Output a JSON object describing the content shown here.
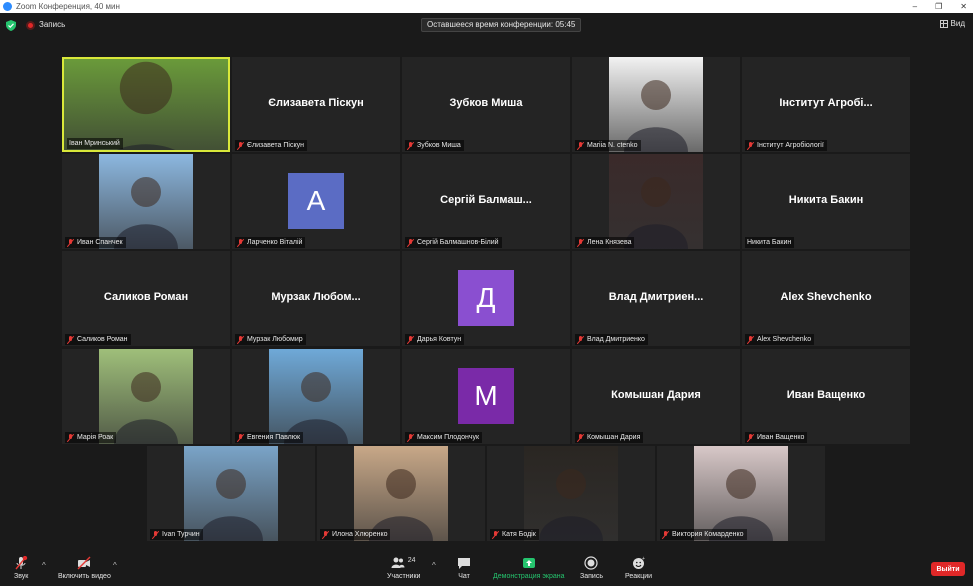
{
  "window": {
    "title": "Zoom Конференция, 40 мин",
    "controls": [
      "–",
      "❐",
      "✕"
    ]
  },
  "topbar": {
    "recording_label": "Запись",
    "timer_text": "Оставшееся время конференции: 05:45",
    "view_label": "Вид"
  },
  "tiles": [
    {
      "id": "ivan-mrynskyi",
      "name": "Іван Мринський",
      "muted": false,
      "active": true,
      "type": "photo",
      "bg": "#6a9a3a"
    },
    {
      "id": "yelyzaveta-piskun",
      "name": "Єлизавета Піскун",
      "display": "Єлизавета Піскун",
      "muted": true,
      "type": "name"
    },
    {
      "id": "zubkov-misha",
      "name": "Зубков Миша",
      "display": "Зубков Миша",
      "muted": true,
      "type": "name"
    },
    {
      "id": "mariia",
      "name": "Mariia N. ctenko",
      "muted": true,
      "type": "photo",
      "bg": "#f2f2f2"
    },
    {
      "id": "instytut",
      "name": "Інститут Агробіології",
      "display": "Інститут Агробі...",
      "muted": true,
      "type": "name"
    },
    {
      "id": "ivan-spanchek",
      "name": "Иван Спанчек",
      "muted": true,
      "type": "photo",
      "bg": "#8cb8e0"
    },
    {
      "id": "larchenko",
      "name": "Ларченко Віталій",
      "muted": true,
      "type": "letter",
      "letter": "A",
      "color": "#5b6cc4"
    },
    {
      "id": "serhii",
      "name": "Сергій Балмашнов-Білий",
      "display": "Сергій Балмаш...",
      "muted": true,
      "type": "name"
    },
    {
      "id": "lena",
      "name": "Лена Князева",
      "muted": true,
      "type": "photo",
      "bg": "#3a2a2a"
    },
    {
      "id": "nikita",
      "name": "Никита Бакин",
      "display": "Никита Бакин",
      "muted": false,
      "type": "name"
    },
    {
      "id": "salikov",
      "name": "Саликов Роман",
      "display": "Саликов Роман",
      "muted": true,
      "type": "name"
    },
    {
      "id": "murzak",
      "name": "Мурзак Любомир",
      "display": "Мурзак Любом...",
      "muted": true,
      "type": "name"
    },
    {
      "id": "darya",
      "name": "Дарья Ковтун",
      "muted": true,
      "type": "letter",
      "letter": "Д",
      "color": "#8a4fd0"
    },
    {
      "id": "vlad",
      "name": "Влад Дмитриенко",
      "display": "Влад Дмитриен...",
      "muted": true,
      "type": "name"
    },
    {
      "id": "alex",
      "name": "Alex Shevchenko",
      "display": "Alex Shevchenko",
      "muted": true,
      "type": "name"
    },
    {
      "id": "mariia-r",
      "name": "Марія Роак",
      "muted": true,
      "type": "photo",
      "bg": "#9fbf7a"
    },
    {
      "id": "yevheniia",
      "name": "Евгения Павлюк",
      "muted": true,
      "type": "photo",
      "bg": "#6fa9d8"
    },
    {
      "id": "maksym",
      "name": "Максим Плодончук",
      "muted": true,
      "type": "letter",
      "letter": "М",
      "color": "#7a2aa8"
    },
    {
      "id": "komyshan",
      "name": "Комышан Дария",
      "display": "Комышан Дария",
      "muted": true,
      "type": "name"
    },
    {
      "id": "vashchenko",
      "name": "Иван Ващенко",
      "display": "Иван Ващенко",
      "muted": true,
      "type": "name"
    },
    {
      "id": "ivan-turchyn",
      "name": "Ivan Турчин",
      "muted": true,
      "type": "photo",
      "bg": "#7aa4c8"
    },
    {
      "id": "ilona",
      "name": "Илона Хлюренко",
      "muted": true,
      "type": "photo",
      "bg": "#c8a888"
    },
    {
      "id": "katia",
      "name": "Катя Бодік",
      "muted": true,
      "type": "photo",
      "bg": "#2a2622"
    },
    {
      "id": "viktoriia",
      "name": "Виктория Комарденко",
      "muted": true,
      "type": "photo",
      "bg": "#d8c8c8"
    }
  ],
  "toolbar": {
    "audio_label": "Звук",
    "video_label": "Включить видео",
    "participants_label": "Участники",
    "participants_count": "24",
    "chat_label": "Чат",
    "share_label": "Демонстрация экрана",
    "record_label": "Запись",
    "reactions_label": "Реакции",
    "leave_label": "Выйти"
  },
  "colors": {
    "accent_share": "#25c46e",
    "leave": "#e02828",
    "active_speaker": "#d9e83a"
  }
}
